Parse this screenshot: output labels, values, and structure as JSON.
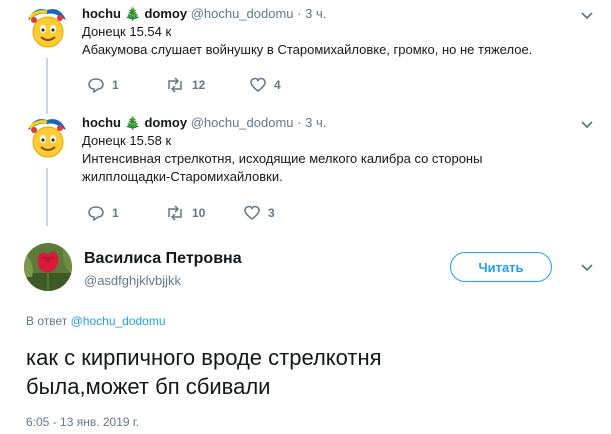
{
  "tweet1": {
    "name_part1": "hochu",
    "name_emoji": "🎄",
    "name_part2": "domoy",
    "handle": "@hochu_dodomu",
    "sep": "·",
    "time": "3 ч.",
    "line1": "Донецк 15.54 к",
    "line2": "Абакумова слушает войнушку в Старомихайловке, громко, но не тяжелое.",
    "replies": "1",
    "retweets": "12",
    "likes": "4"
  },
  "tweet2": {
    "name_part1": "hochu",
    "name_emoji": "🎄",
    "name_part2": "domoy",
    "handle": "@hochu_dodomu",
    "sep": "·",
    "time": "3 ч.",
    "line1": "Донецк  15.58 к",
    "line2": "Интенсивная стрелкотня, исходящие мелкого калибра со стороны",
    "line3": "жилплощадки-Старомихайловки.",
    "replies": "1",
    "retweets": "10",
    "likes": "3"
  },
  "main": {
    "name": "Василиса Петровна",
    "handle": "@asdfghjklvbjjkk",
    "follow_label": "Читать",
    "reply_prefix": "В ответ",
    "reply_handle": "@hochu_dodomu",
    "text_line1": "как с кирпичного вроде стрелкотня",
    "text_line2": "была,может бп сбивали",
    "date": "6:05 - 13 янв. 2019 г."
  },
  "colors": {
    "accent": "#1da1f2",
    "muted": "#657786",
    "thread": "#ccd6dd"
  }
}
